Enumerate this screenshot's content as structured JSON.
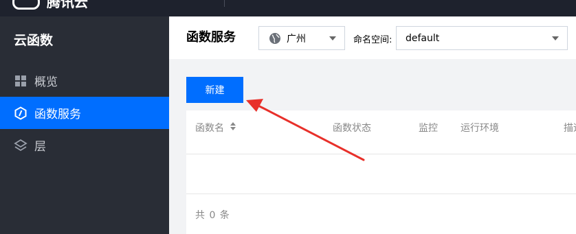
{
  "topbar": {
    "logo_text": "腾讯云"
  },
  "sidebar": {
    "title": "云函数",
    "items": [
      {
        "label": "概览",
        "icon": "grid-icon",
        "active": false
      },
      {
        "label": "函数服务",
        "icon": "hexagon-function-icon",
        "active": true
      },
      {
        "label": "层",
        "icon": "layers-icon",
        "active": false
      }
    ]
  },
  "header": {
    "title": "函数服务",
    "region": {
      "value": "广州",
      "icon": "globe-icon"
    },
    "namespace": {
      "label": "命名空间:",
      "value": "default"
    }
  },
  "toolbar": {
    "new_label": "新建"
  },
  "table": {
    "columns": [
      "函数名",
      "函数状态",
      "监控",
      "运行环境",
      "描述"
    ],
    "rows": [],
    "footer": "共 0 条"
  },
  "colors": {
    "accent": "#006eff",
    "sidebar_bg": "#292d36",
    "annotation": "#e8302a"
  }
}
